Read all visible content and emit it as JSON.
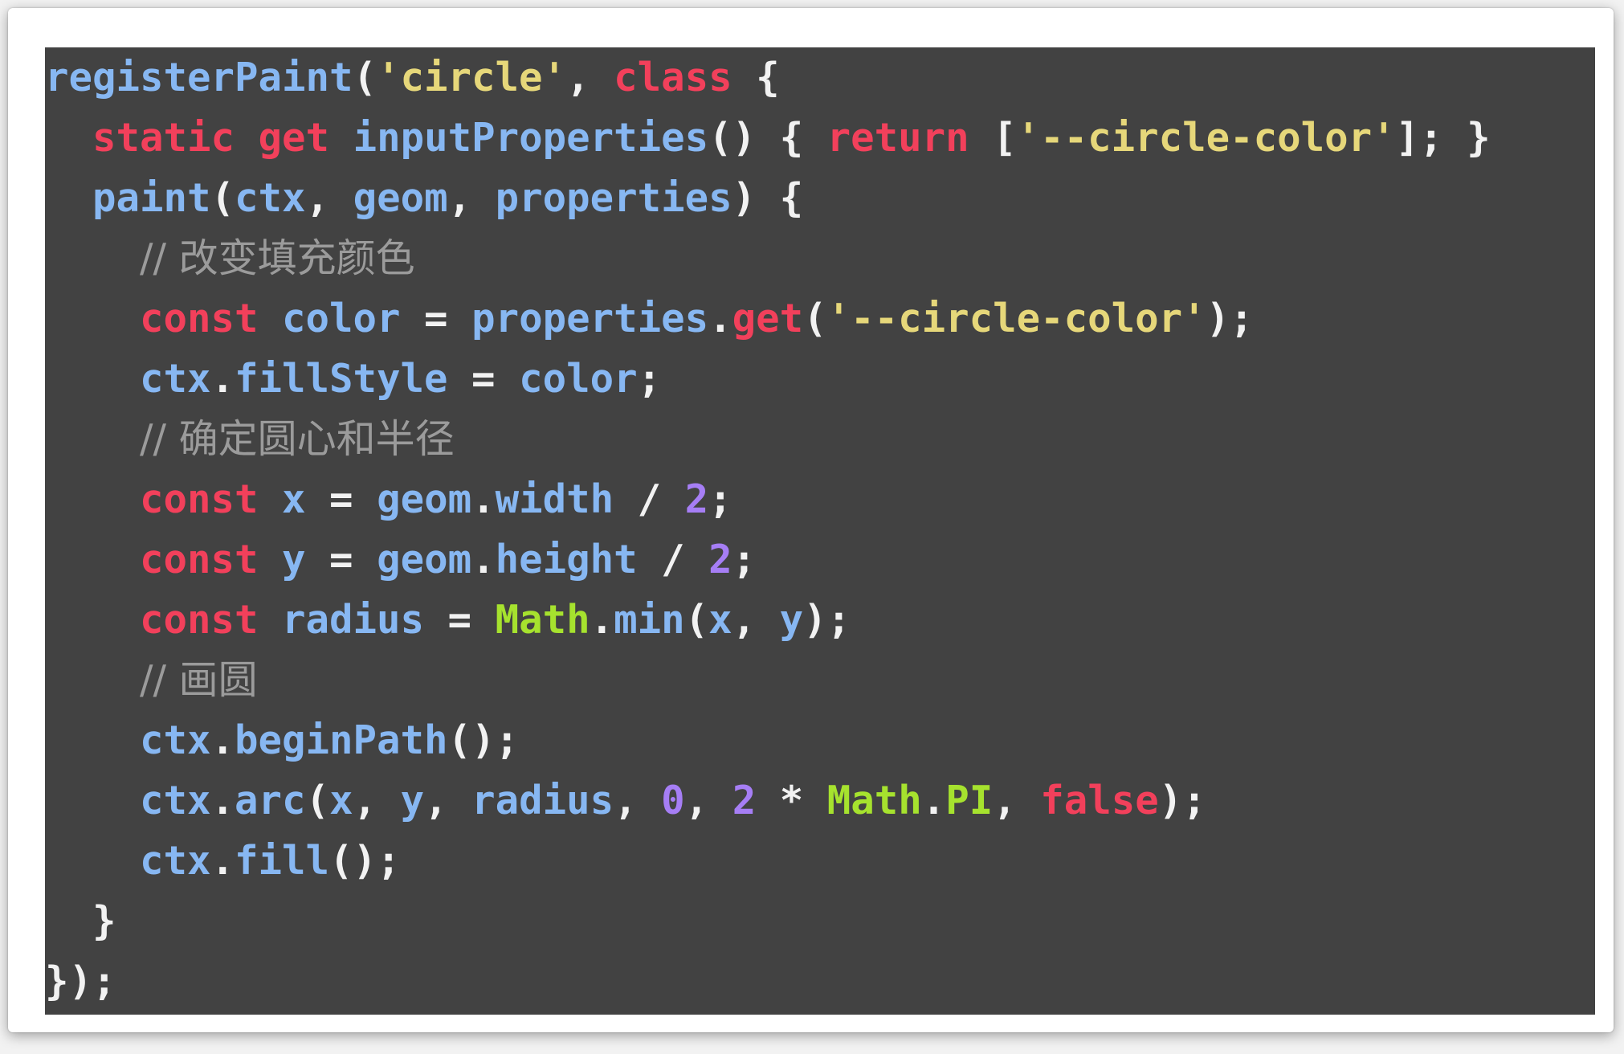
{
  "colors": {
    "background": "#424242",
    "plain": "#87b7f2",
    "keyword": "#f2405b",
    "string": "#e6d77a",
    "number": "#a67ef5",
    "builtin": "#a6e22e",
    "comment": "#9b9b9b",
    "punctuation": "#f2f2f2"
  },
  "code": {
    "lines": [
      [
        [
          "plain",
          "registerPaint"
        ],
        [
          "punct",
          "("
        ],
        [
          "str",
          "'circle'"
        ],
        [
          "punct",
          ", "
        ],
        [
          "kw",
          "class"
        ],
        [
          "punct",
          " {"
        ]
      ],
      [
        [
          "plain",
          "  "
        ],
        [
          "kw",
          "static"
        ],
        [
          "plain",
          " "
        ],
        [
          "kw",
          "get"
        ],
        [
          "plain",
          " inputProperties"
        ],
        [
          "punct",
          "() { "
        ],
        [
          "kw",
          "return"
        ],
        [
          "punct",
          " ["
        ],
        [
          "str",
          "'--circle-color'"
        ],
        [
          "punct",
          "]; }"
        ]
      ],
      [
        [
          "plain",
          "  paint"
        ],
        [
          "punct",
          "("
        ],
        [
          "plain",
          "ctx"
        ],
        [
          "punct",
          ", "
        ],
        [
          "plain",
          "geom"
        ],
        [
          "punct",
          ", "
        ],
        [
          "plain",
          "properties"
        ],
        [
          "punct",
          ") {"
        ]
      ],
      [
        [
          "plain",
          "    "
        ],
        [
          "comment",
          "// 改变填充颜色"
        ]
      ],
      [
        [
          "plain",
          "    "
        ],
        [
          "kw",
          "const"
        ],
        [
          "plain",
          " color "
        ],
        [
          "punct",
          "= "
        ],
        [
          "plain",
          "properties"
        ],
        [
          "punct",
          "."
        ],
        [
          "kw",
          "get"
        ],
        [
          "punct",
          "("
        ],
        [
          "str",
          "'--circle-color'"
        ],
        [
          "punct",
          ");"
        ]
      ],
      [
        [
          "plain",
          "    ctx"
        ],
        [
          "punct",
          "."
        ],
        [
          "plain",
          "fillStyle "
        ],
        [
          "punct",
          "= "
        ],
        [
          "plain",
          "color"
        ],
        [
          "punct",
          ";"
        ]
      ],
      [
        [
          "plain",
          "    "
        ],
        [
          "comment",
          "// 确定圆心和半径"
        ]
      ],
      [
        [
          "plain",
          "    "
        ],
        [
          "kw",
          "const"
        ],
        [
          "plain",
          " x "
        ],
        [
          "punct",
          "= "
        ],
        [
          "plain",
          "geom"
        ],
        [
          "punct",
          "."
        ],
        [
          "plain",
          "width "
        ],
        [
          "punct",
          "/ "
        ],
        [
          "num",
          "2"
        ],
        [
          "punct",
          ";"
        ]
      ],
      [
        [
          "plain",
          "    "
        ],
        [
          "kw",
          "const"
        ],
        [
          "plain",
          " y "
        ],
        [
          "punct",
          "= "
        ],
        [
          "plain",
          "geom"
        ],
        [
          "punct",
          "."
        ],
        [
          "plain",
          "height "
        ],
        [
          "punct",
          "/ "
        ],
        [
          "num",
          "2"
        ],
        [
          "punct",
          ";"
        ]
      ],
      [
        [
          "plain",
          "    "
        ],
        [
          "kw",
          "const"
        ],
        [
          "plain",
          " radius "
        ],
        [
          "punct",
          "= "
        ],
        [
          "builtin",
          "Math"
        ],
        [
          "punct",
          "."
        ],
        [
          "plain",
          "min"
        ],
        [
          "punct",
          "("
        ],
        [
          "plain",
          "x"
        ],
        [
          "punct",
          ", "
        ],
        [
          "plain",
          "y"
        ],
        [
          "punct",
          ");"
        ]
      ],
      [
        [
          "plain",
          "    "
        ],
        [
          "comment",
          "// 画圆"
        ]
      ],
      [
        [
          "plain",
          "    ctx"
        ],
        [
          "punct",
          "."
        ],
        [
          "plain",
          "beginPath"
        ],
        [
          "punct",
          "();"
        ]
      ],
      [
        [
          "plain",
          "    ctx"
        ],
        [
          "punct",
          "."
        ],
        [
          "plain",
          "arc"
        ],
        [
          "punct",
          "("
        ],
        [
          "plain",
          "x"
        ],
        [
          "punct",
          ", "
        ],
        [
          "plain",
          "y"
        ],
        [
          "punct",
          ", "
        ],
        [
          "plain",
          "radius"
        ],
        [
          "punct",
          ", "
        ],
        [
          "num",
          "0"
        ],
        [
          "punct",
          ", "
        ],
        [
          "num",
          "2"
        ],
        [
          "punct",
          " * "
        ],
        [
          "builtin",
          "Math"
        ],
        [
          "punct",
          "."
        ],
        [
          "builtin",
          "PI"
        ],
        [
          "punct",
          ", "
        ],
        [
          "kw",
          "false"
        ],
        [
          "punct",
          ");"
        ]
      ],
      [
        [
          "plain",
          "    ctx"
        ],
        [
          "punct",
          "."
        ],
        [
          "plain",
          "fill"
        ],
        [
          "punct",
          "();"
        ]
      ],
      [
        [
          "punct",
          "  }"
        ]
      ],
      [
        [
          "punct",
          "});"
        ]
      ]
    ]
  }
}
